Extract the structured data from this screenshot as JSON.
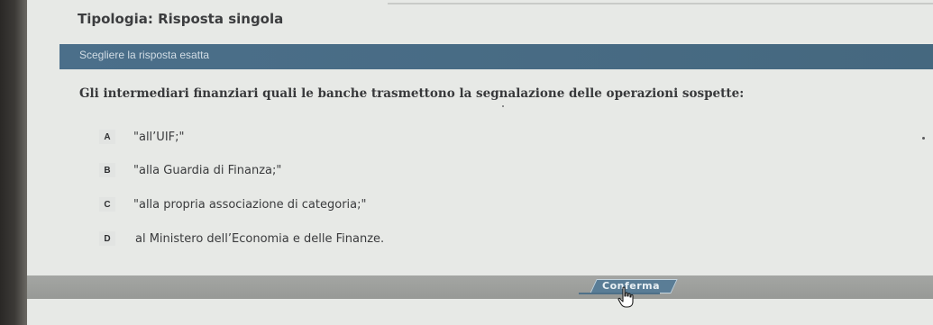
{
  "quiz": {
    "type_label": "Tipologia: Risposta singola",
    "instruction": "Scegliere la risposta esatta",
    "question": "Gli intermediari finanziari quali le banche trasmettono la segnalazione delle operazioni sospette:",
    "answers": [
      {
        "letter": "A",
        "text": "\"all’UIF;\""
      },
      {
        "letter": "B",
        "text": "\"alla Guardia di Finanza;\""
      },
      {
        "letter": "C",
        "text": "\"alla propria associazione di categoria;\""
      },
      {
        "letter": "D",
        "text": "al Ministero dell’Economia e delle Finanze."
      }
    ]
  },
  "footer": {
    "confirm_label": "Conferma"
  },
  "colors": {
    "instruction_bar": "#4b6f8a",
    "bottom_bar": "#9d9f9c",
    "confirm_button": "#5a7d96"
  },
  "icons": {
    "cursor": "hand-pointer-icon"
  }
}
